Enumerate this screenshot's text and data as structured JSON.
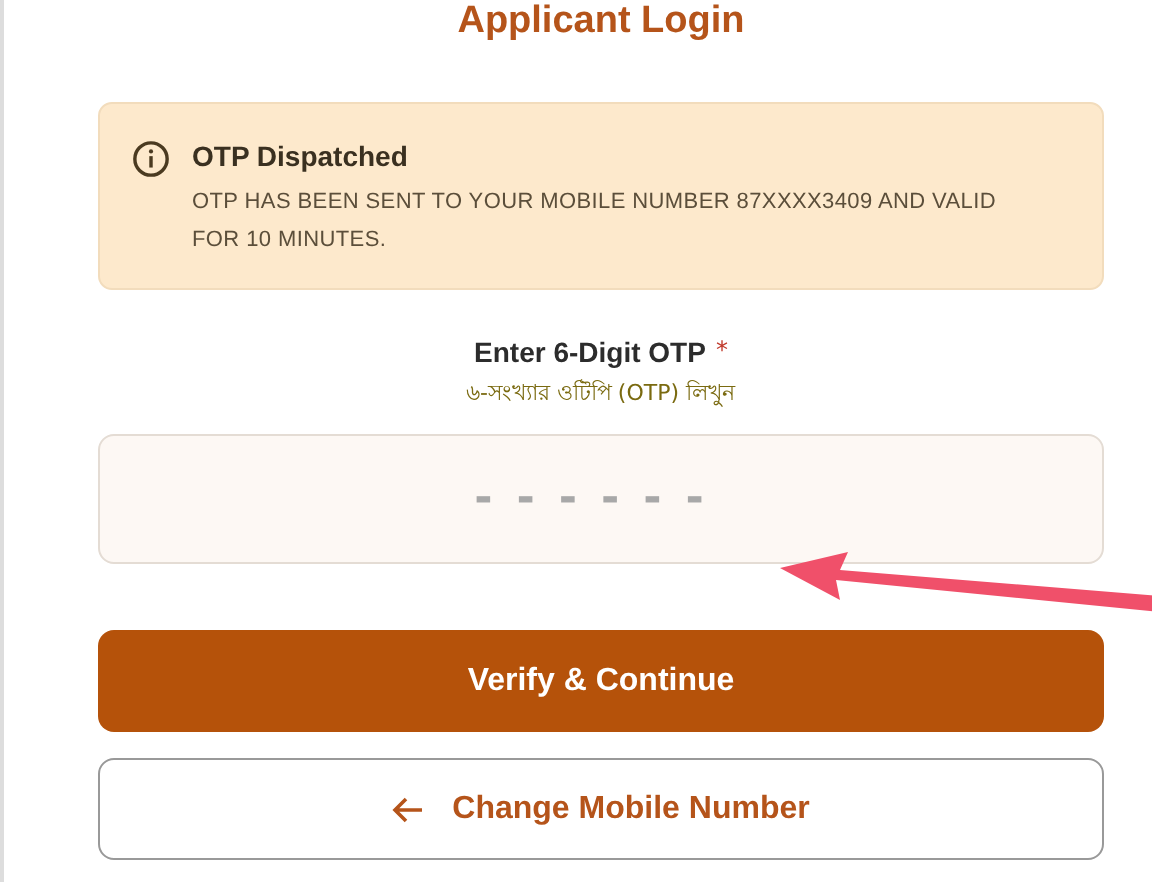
{
  "title": "Applicant Login",
  "alert": {
    "title": "OTP Dispatched",
    "message": "OTP HAS BEEN SENT TO YOUR MOBILE NUMBER 87XXXX3409 AND VALID FOR 10 MINUTES."
  },
  "otp_field": {
    "label": "Enter 6-Digit OTP",
    "required_mark": "*",
    "sublabel": "৬-সংখ্যার ওটিপি (OTP) লিখুন",
    "placeholder": "------"
  },
  "buttons": [
    {
      "label": "Verify & Continue",
      "kind": "primary"
    },
    {
      "label": "Change Mobile Number",
      "kind": "back"
    }
  ]
}
